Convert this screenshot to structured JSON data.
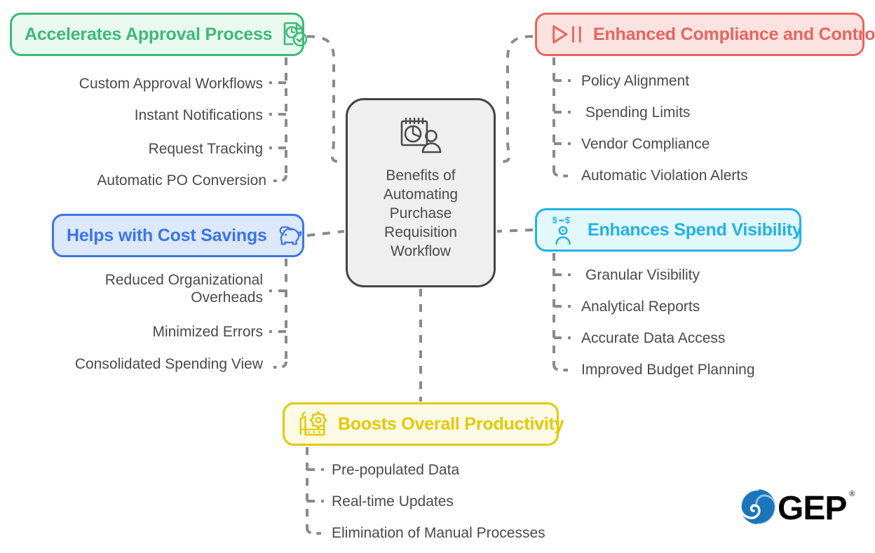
{
  "center": {
    "icon": "calendar-chart-person-icon",
    "title": "Benefits of Automating Purchase Requisition Workflow"
  },
  "branches": [
    {
      "id": "approval",
      "label": "Accelerates Approval Process",
      "icon": "document-clock-check-icon",
      "color": "#3dba78",
      "fill": "#e9f9f0",
      "items": [
        "Custom Approval Workflows",
        "Instant Notifications",
        "Request Tracking",
        "Automatic PO Conversion"
      ]
    },
    {
      "id": "compliance",
      "label": "Enhanced Compliance and Control",
      "icon": "play-pause-icon",
      "color": "#e8655f",
      "fill": "#fbe3e1",
      "items": [
        "Policy Alignment",
        "Spending Limits",
        "Vendor Compliance",
        "Automatic Violation Alerts"
      ]
    },
    {
      "id": "cost",
      "label": "Helps with Cost Savings",
      "icon": "piggy-bank-icon",
      "color": "#3b76e8",
      "fill": "#dde8fd",
      "items": [
        "Reduced Organizational\nOverheads",
        "Minimized Errors",
        "Consolidated Spending View"
      ]
    },
    {
      "id": "spend",
      "label": "Enhances Spend Visibility",
      "icon": "person-dollar-icon",
      "color": "#23b2e5",
      "fill": "#e2f8fd",
      "items": [
        "Granular Visibility",
        "Analytical Reports",
        "Accurate Data Access",
        "Improved Budget Planning"
      ]
    },
    {
      "id": "productivity",
      "label": "Boosts Overall Productivity",
      "icon": "factory-gear-icon",
      "color": "#e3c902",
      "fill": "#fdfbe6",
      "items": [
        "Pre-populated Data",
        "Real-time Updates",
        "Elimination of Manual Processes"
      ]
    }
  ],
  "logo": {
    "word": "GEP",
    "registered": "®",
    "mark_color": "#1b75bb"
  },
  "style": {
    "connector_color": "#8a8a8a",
    "text_color": "#4a4a4a",
    "center_border": "#444444",
    "center_fill": "#efefef"
  }
}
